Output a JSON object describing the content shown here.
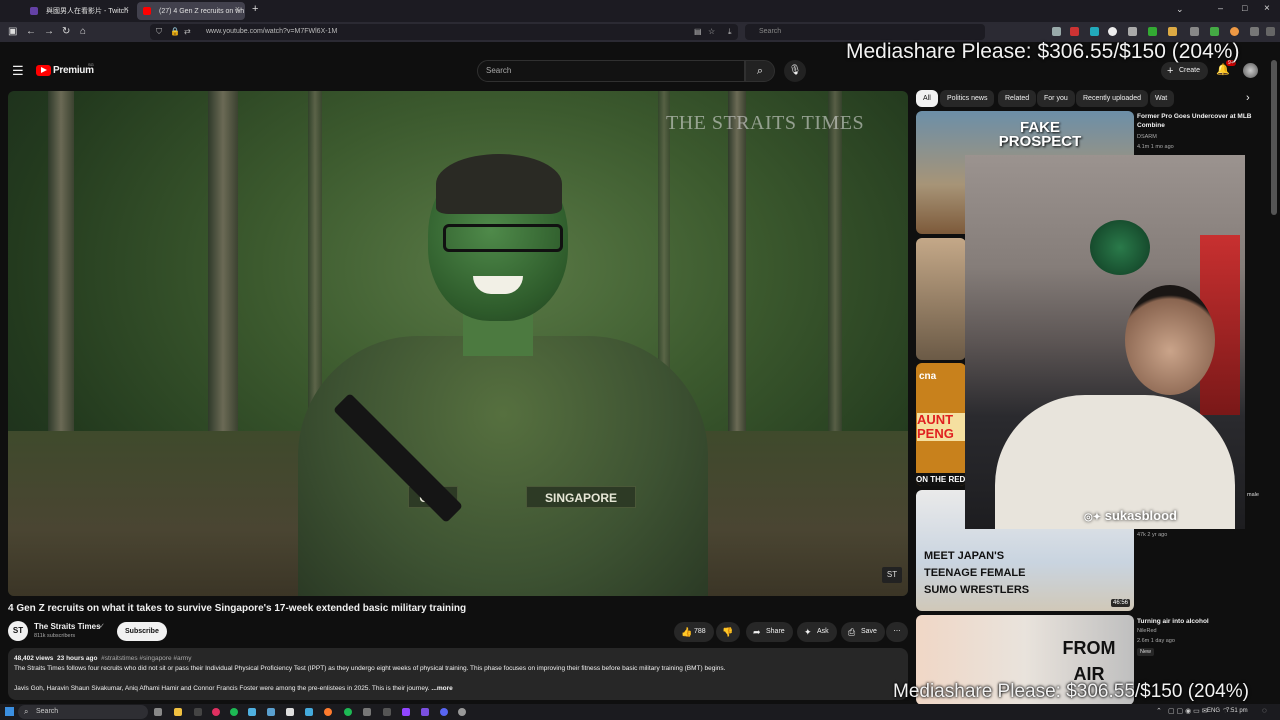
{
  "browser": {
    "tabs": [
      {
        "label": "與國男人在看影片 - Twitch",
        "color": "#6441a5"
      },
      {
        "label": "(27) 4 Gen Z recruits on wh",
        "color": "#ff0000"
      }
    ],
    "url": "www.youtube.com/watch?v=M7FWl6X-1M",
    "search_placeholder": "Search"
  },
  "youtube": {
    "logo": "Premium",
    "logo_sup": "SG",
    "search_placeholder": "Search",
    "create_label": "Create",
    "notif_count": "9+",
    "chips": [
      "All",
      "Politics news",
      "Related",
      "For you",
      "Recently uploaded",
      "Wat"
    ],
    "video": {
      "watermark": "THE STRAITS TIMES",
      "logo_small": "ST",
      "tag_name": "GOH",
      "tag_country": "SINGAPORE",
      "title": "4 Gen Z recruits on what it takes to survive Singapore's 17-week extended basic military training",
      "channel": "The Straits Times",
      "subscribers": "811k subscribers",
      "subscribe_label": "Subscribe",
      "likes": "788",
      "share_label": "Share",
      "ask_label": "Ask",
      "save_label": "Save",
      "views": "48,402 views",
      "age": "23 hours ago",
      "tags": "#straitstimes #singapore #army",
      "desc1": "The Straits Times follows four recruits who did not sit or pass their Individual Physical Proficiency Test (IPPT) as they undergo eight weeks of physical training. This phase focuses on improving their fitness before basic military training (BMT) begins.",
      "desc2": "Javis Goh, Haravin Shaun Sivakumar, Aniq Afhami Hamir and Connor Francis Foster were among the pre-enlistees in 2025. This is their journey.",
      "more_label": "...more"
    },
    "sidebar": [
      {
        "thumb_text": "FAKE PROSPECT",
        "title": "Former Pro Goes Undercover at MLB Combine",
        "channel": "DSARM",
        "meta": "4.1m  1 mo ago"
      },
      {
        "thumb_text": "AUNT PENG",
        "thumb_sub": "ON THE RED",
        "badge": "cna"
      },
      {
        "thumb_text": "MEET JAPAN'S TEENAGE FEMALE SUMO WRESTLERS",
        "duration": "46:56",
        "meta": "47k  2 yr ago",
        "side_text": "male"
      },
      {
        "thumb_text": "FROM AIR",
        "title": "Turning air into alcohol",
        "channel": "NileRed",
        "meta": "2.6m  1 day ago",
        "badge": "New"
      }
    ]
  },
  "stream": {
    "mediashare_top": "Mediashare Please: $306.55/$150 (204%)",
    "mediashare_bottom": "Mediashare Please: $306.55/$150 (204%)",
    "handle": "sukasblood"
  },
  "taskbar": {
    "search_label": "Search",
    "lang": "ENG",
    "time": "7:51 pm"
  }
}
